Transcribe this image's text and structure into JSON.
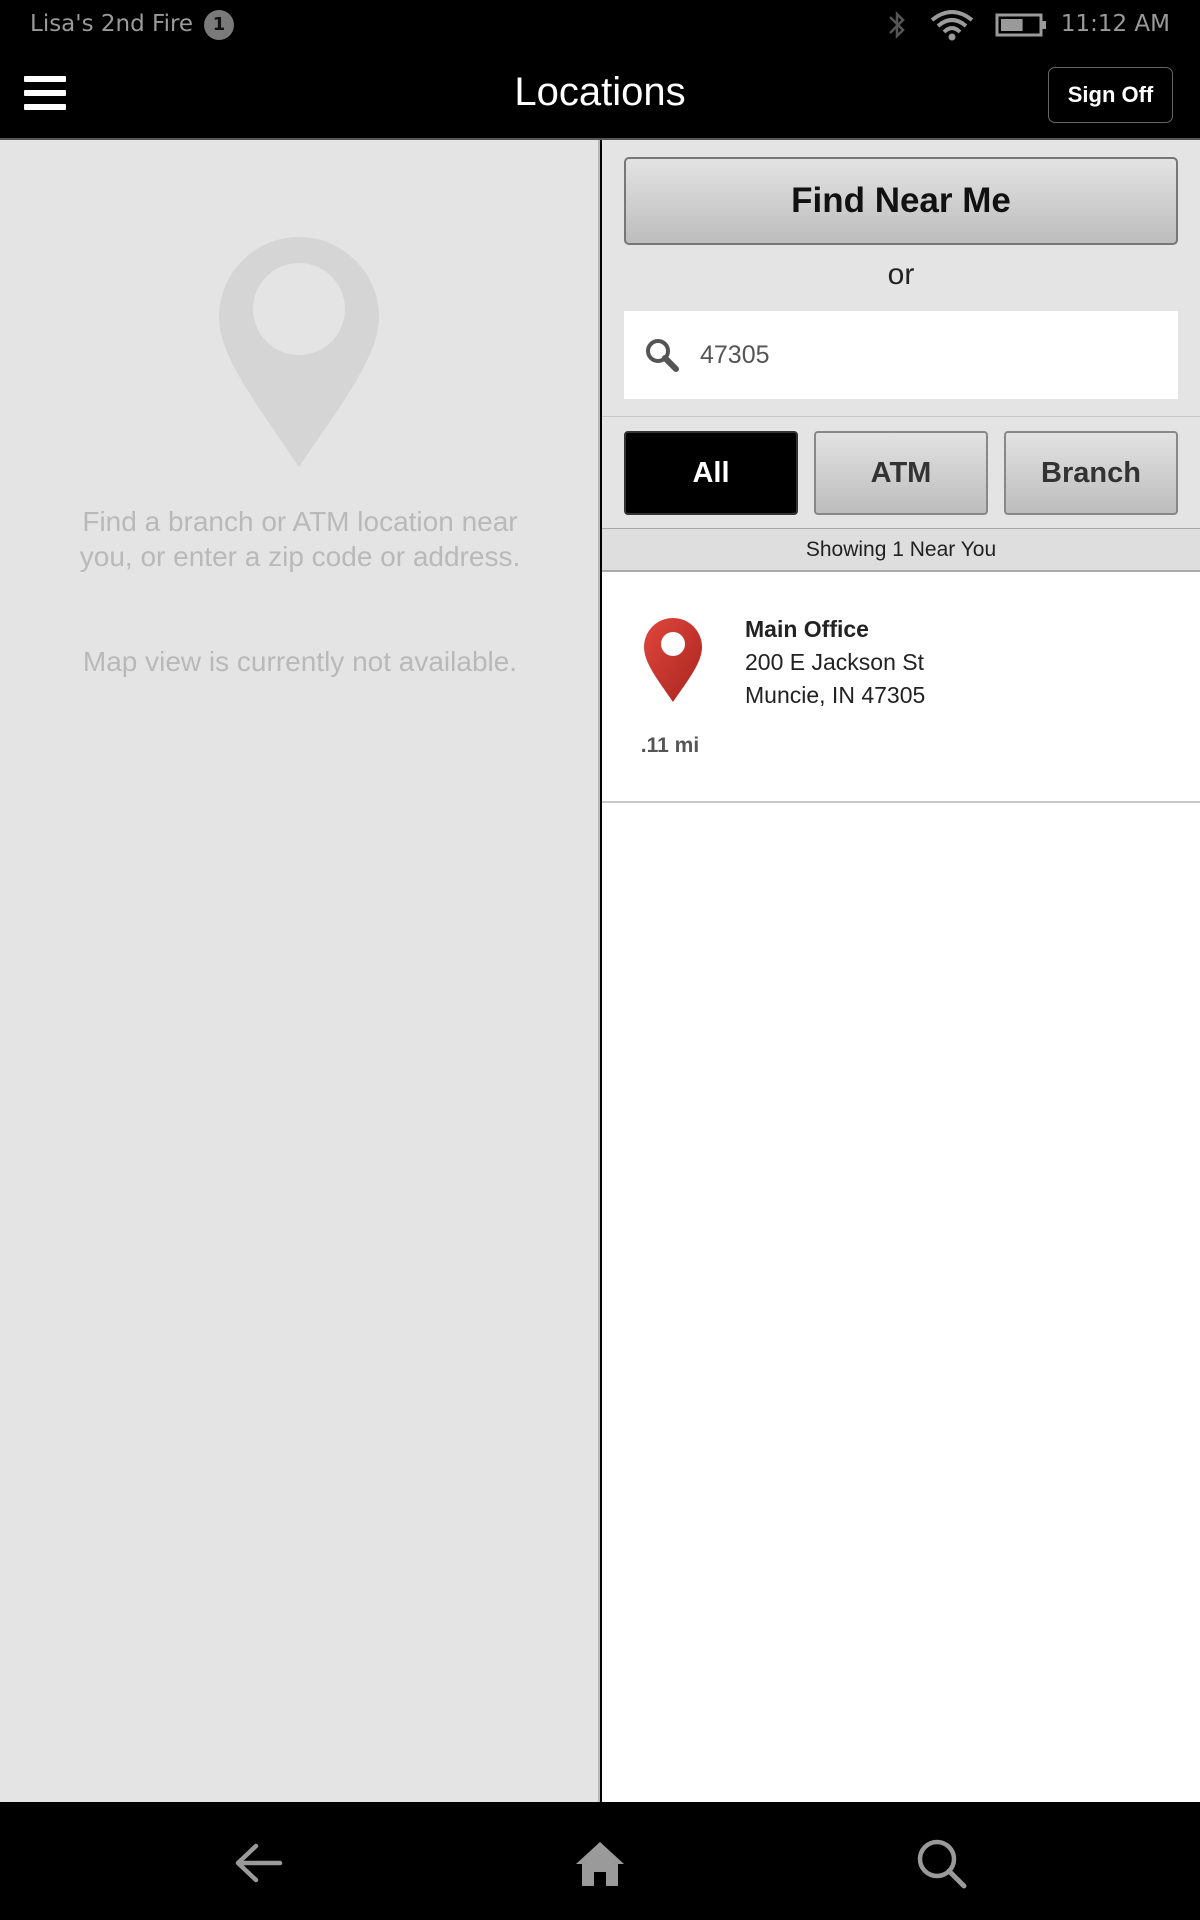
{
  "status_bar": {
    "device_name": "Lisa's 2nd Fire",
    "notification_count": "1",
    "time": "11:12 AM",
    "battery_level": 0.6,
    "icons": [
      "bluetooth-icon",
      "wifi-icon",
      "battery-icon"
    ]
  },
  "app_bar": {
    "title": "Locations",
    "sign_off_label": "Sign Off",
    "menu_icon": "hamburger-menu-icon"
  },
  "map_pane": {
    "message": "Find a branch or ATM location near you, or enter a zip code or address.",
    "unavailable": "Map view is currently not available."
  },
  "search": {
    "find_near_me_label": "Find Near Me",
    "or_label": "or",
    "query": "47305"
  },
  "filters": {
    "all": "All",
    "atm": "ATM",
    "branch": "Branch",
    "selected": "All"
  },
  "results": {
    "summary": "Showing 1 Near You",
    "items": [
      {
        "name": "Main Office",
        "street": "200 E Jackson St",
        "city_line": "Muncie, IN 47305",
        "distance": ".11 mi"
      }
    ]
  },
  "nav_bar": {
    "icons": [
      "back-icon",
      "home-icon",
      "search-icon"
    ]
  },
  "colors": {
    "pin_red": "#c0302a",
    "map_background": "#e4e4e4",
    "active_filter": "#000000"
  }
}
